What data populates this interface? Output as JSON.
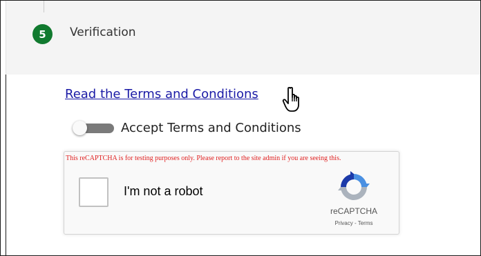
{
  "step": {
    "number": "5",
    "title": "Verification"
  },
  "verification": {
    "terms_link": "Read the Terms and Conditions",
    "accept_label": "Accept Terms and Conditions",
    "accept_toggle_on": false
  },
  "recaptcha": {
    "warning": "This reCAPTCHA is for testing purposes only. Please report to the site admin if you are seeing this.",
    "checkbox_label": "I'm not a robot",
    "brand": "reCAPTCHA",
    "privacy_link": "Privacy",
    "separator": "-",
    "terms_link": "Terms"
  },
  "colors": {
    "step_badge": "#117a2f",
    "header_bg": "#f4f4f4",
    "link": "#1a1aa6",
    "warning": "#e02020"
  },
  "icons": {
    "cursor": "hand-pointer-icon",
    "recaptcha_logo": "recaptcha-logo-icon"
  }
}
